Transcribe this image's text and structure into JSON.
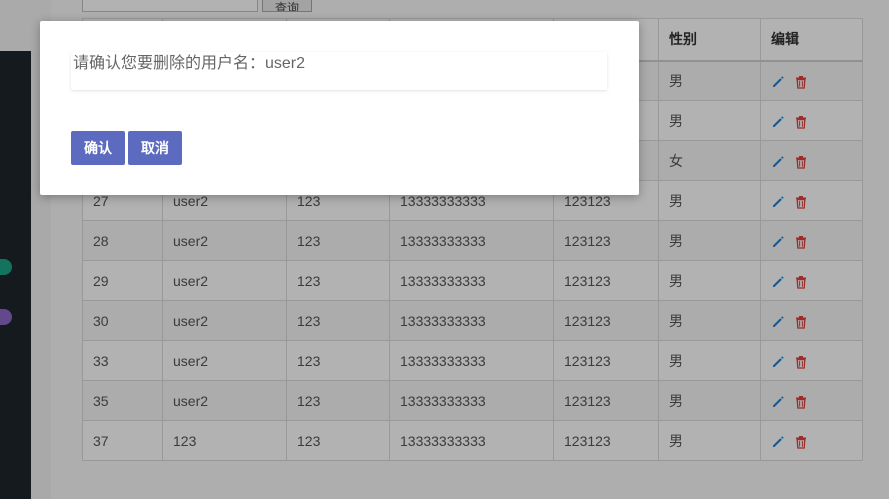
{
  "search": {
    "button_label": "查询"
  },
  "table": {
    "headers": {
      "gender": "性别",
      "edit": "编辑"
    },
    "hidden_rows": [
      {
        "gender": "男"
      },
      {
        "gender": "男"
      },
      {
        "gender": "女"
      }
    ],
    "rows": [
      {
        "id": "27",
        "username": "user2",
        "password": "123",
        "phone": "13333333333",
        "code": "123123",
        "gender": "男"
      },
      {
        "id": "28",
        "username": "user2",
        "password": "123",
        "phone": "13333333333",
        "code": "123123",
        "gender": "男"
      },
      {
        "id": "29",
        "username": "user2",
        "password": "123",
        "phone": "13333333333",
        "code": "123123",
        "gender": "男"
      },
      {
        "id": "30",
        "username": "user2",
        "password": "123",
        "phone": "13333333333",
        "code": "123123",
        "gender": "男"
      },
      {
        "id": "33",
        "username": "user2",
        "password": "123",
        "phone": "13333333333",
        "code": "123123",
        "gender": "男"
      },
      {
        "id": "35",
        "username": "user2",
        "password": "123",
        "phone": "13333333333",
        "code": "123123",
        "gender": "男"
      },
      {
        "id": "37",
        "username": "123",
        "password": "123",
        "phone": "13333333333",
        "code": "123123",
        "gender": "男"
      }
    ],
    "edit_icon": "pencil-icon",
    "delete_icon": "trash-icon"
  },
  "modal": {
    "message": "请确认您要删除的用户名：user2",
    "confirm_label": "确认",
    "cancel_label": "取消"
  },
  "colors": {
    "primary_button": "#5c6bc0",
    "edit_icon": "#2a7fc9",
    "delete_icon": "#e0403a",
    "sidebar": "#1f262d"
  }
}
